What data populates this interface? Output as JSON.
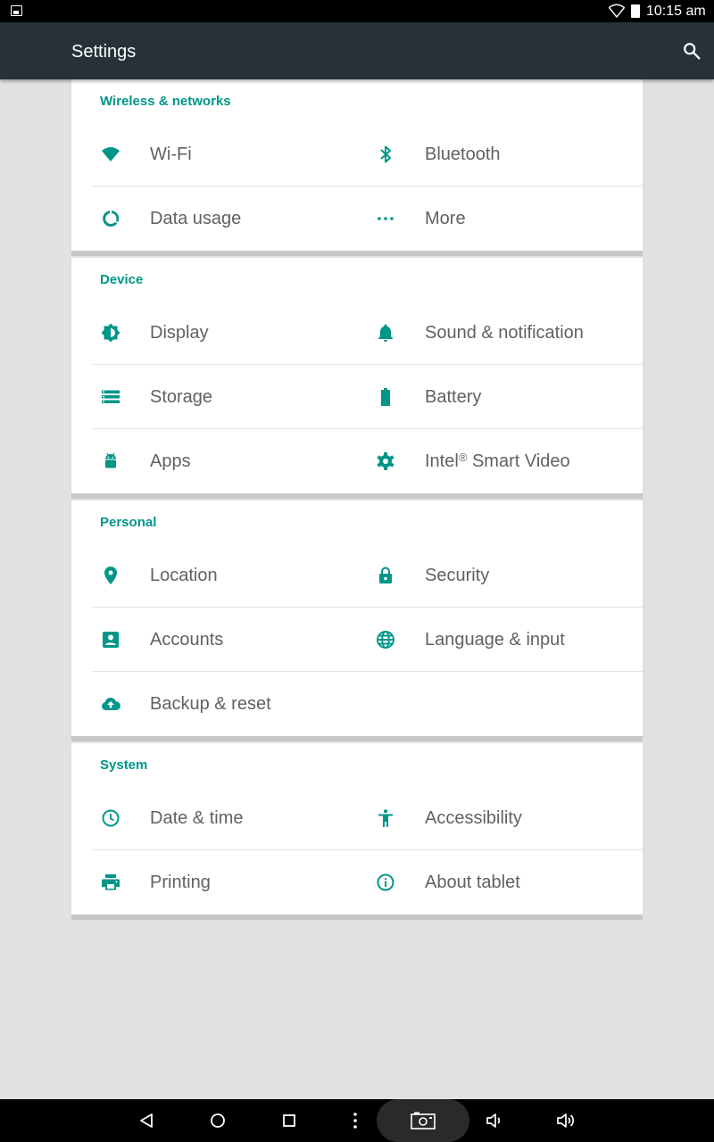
{
  "status_bar": {
    "time": "10:15 am"
  },
  "app_bar": {
    "title": "Settings"
  },
  "sections": [
    {
      "title": "Wireless & networks",
      "items": [
        {
          "label": "Wi-Fi",
          "icon": "wifi-icon"
        },
        {
          "label": "Bluetooth",
          "icon": "bluetooth-icon"
        },
        {
          "label": "Data usage",
          "icon": "data-usage-icon"
        },
        {
          "label": "More",
          "icon": "more-icon"
        }
      ]
    },
    {
      "title": "Device",
      "items": [
        {
          "label": "Display",
          "icon": "display-icon"
        },
        {
          "label": "Sound & notification",
          "icon": "bell-icon"
        },
        {
          "label": "Storage",
          "icon": "storage-icon"
        },
        {
          "label": "Battery",
          "icon": "battery-icon"
        },
        {
          "label": "Apps",
          "icon": "android-icon"
        },
        {
          "label": "Intel",
          "label_sup": "®",
          "label_suffix": " Smart Video",
          "icon": "gear-icon"
        }
      ]
    },
    {
      "title": "Personal",
      "items": [
        {
          "label": "Location",
          "icon": "location-pin-icon"
        },
        {
          "label": "Security",
          "icon": "lock-icon"
        },
        {
          "label": "Accounts",
          "icon": "account-icon"
        },
        {
          "label": "Language & input",
          "icon": "globe-icon"
        },
        {
          "label": "Backup & reset",
          "icon": "cloud-upload-icon"
        }
      ]
    },
    {
      "title": "System",
      "items": [
        {
          "label": "Date & time",
          "icon": "clock-icon"
        },
        {
          "label": "Accessibility",
          "icon": "accessibility-icon"
        },
        {
          "label": "Printing",
          "icon": "printer-icon"
        },
        {
          "label": "About tablet",
          "icon": "info-icon"
        }
      ]
    }
  ],
  "nav_bar": {
    "icons": [
      "back-icon",
      "home-icon",
      "recents-icon",
      "menu-dots-icon",
      "screenshot-icon",
      "volume-down-icon",
      "volume-up-icon"
    ]
  },
  "colors": {
    "accent": "#009688",
    "app_bar": "#263238",
    "background": "#e1e1df",
    "label_text": "#616161"
  }
}
